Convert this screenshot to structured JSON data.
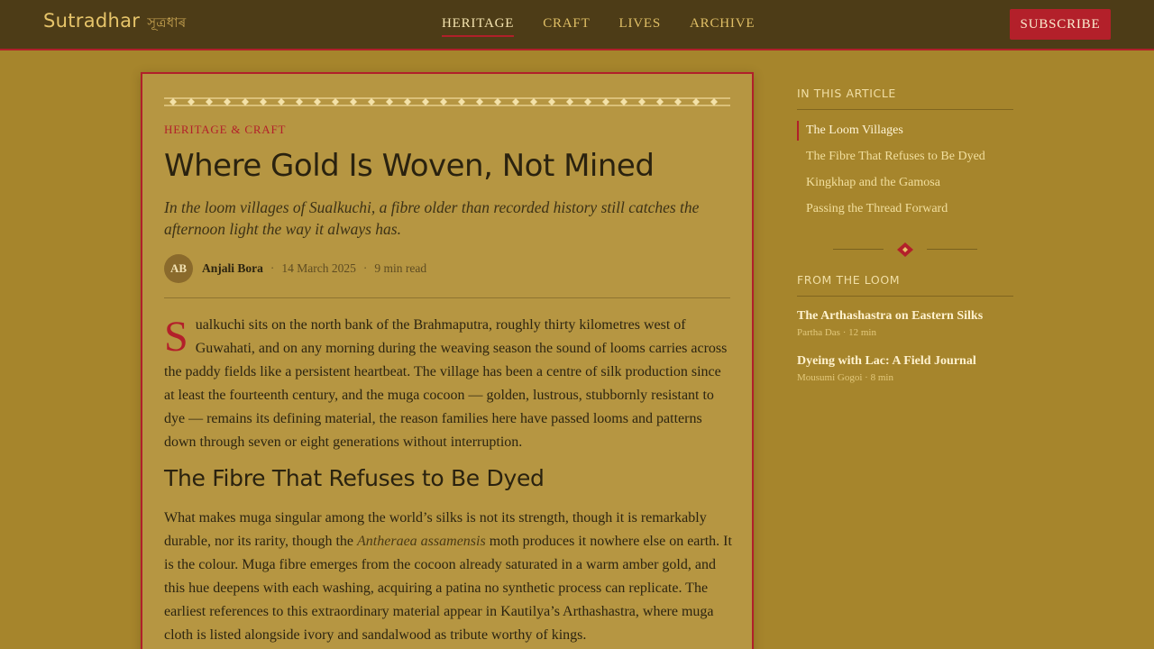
{
  "site": {
    "name": "Sutradhar",
    "name_native": "সূত্ৰধাৰ"
  },
  "nav": {
    "items": [
      {
        "label": "HERITAGE",
        "active": true
      },
      {
        "label": "CRAFT",
        "active": false
      },
      {
        "label": "LIVES",
        "active": false
      },
      {
        "label": "ARCHIVE",
        "active": false
      }
    ],
    "subscribe_label": "SUBSCRIBE"
  },
  "article": {
    "kicker": "HERITAGE & CRAFT",
    "title": "Where Gold Is Woven, Not Mined",
    "dek": "In the loom villages of Sualkuchi, a fibre older than recorded history still catches the afternoon light the way it always has.",
    "author_initials": "AB",
    "author": "Anjali Bora",
    "date": "14 March 2025",
    "read_time": "9 min read",
    "separator": "·",
    "drop_cap": "S",
    "para1_rest": "ualkuchi sits on the north bank of the Brahmaputra, roughly thirty kilometres west of Guwahati, and on any morning during the weaving season the sound of looms carries across the paddy fields like a persistent heartbeat. The village has been a centre of silk production since at least the fourteenth century, and the muga cocoon — golden, lustrous, stubbornly resistant to dye — remains its defining material, the reason families here have passed looms and patterns down through seven or eight generations without interruption.",
    "section_heading": "The Fibre That Refuses to Be Dyed",
    "para2_before": "What makes muga singular among the world’s silks is not its strength, though it is remarkably durable, nor its rarity, though the ",
    "para2_species": "Antheraea assamensis",
    "para2_after": " moth produces it nowhere else on earth. It is the colour. Muga fibre emerges from the cocoon already saturated in a warm amber gold, and this hue deepens with each washing, acquiring a patina no synthetic process can replicate. The earliest references to this extraordinary material appear in Kautilya’s Arthashastra, where muga cloth is listed alongside ivory and sandalwood as tribute worthy of kings."
  },
  "sidebar": {
    "toc_heading": "IN THIS ARTICLE",
    "toc": [
      {
        "label": "The Loom Villages",
        "active": true
      },
      {
        "label": "The Fibre That Refuses to Be Dyed",
        "active": false
      },
      {
        "label": "Kingkhap and the Gamosa",
        "active": false
      },
      {
        "label": "Passing the Thread Forward",
        "active": false
      }
    ],
    "related_heading": "FROM THE LOOM",
    "related": [
      {
        "title": "The Arthashastra on Eastern Silks",
        "meta": "Partha Das · 12 min"
      },
      {
        "title": "Dyeing with Lac: A Field Journal",
        "meta": "Mousumi Gogoi · 8 min"
      }
    ]
  },
  "colors": {
    "background": "#a6852c",
    "header": "#4d3c17",
    "accent_red": "#b3202a",
    "card": "#b69642",
    "gold_text": "#e6c46a"
  },
  "icons": {
    "header_ornament": "diamond-border-ornament",
    "sidebar_divider": "diamond-icon",
    "author_avatar": "initials-avatar"
  }
}
